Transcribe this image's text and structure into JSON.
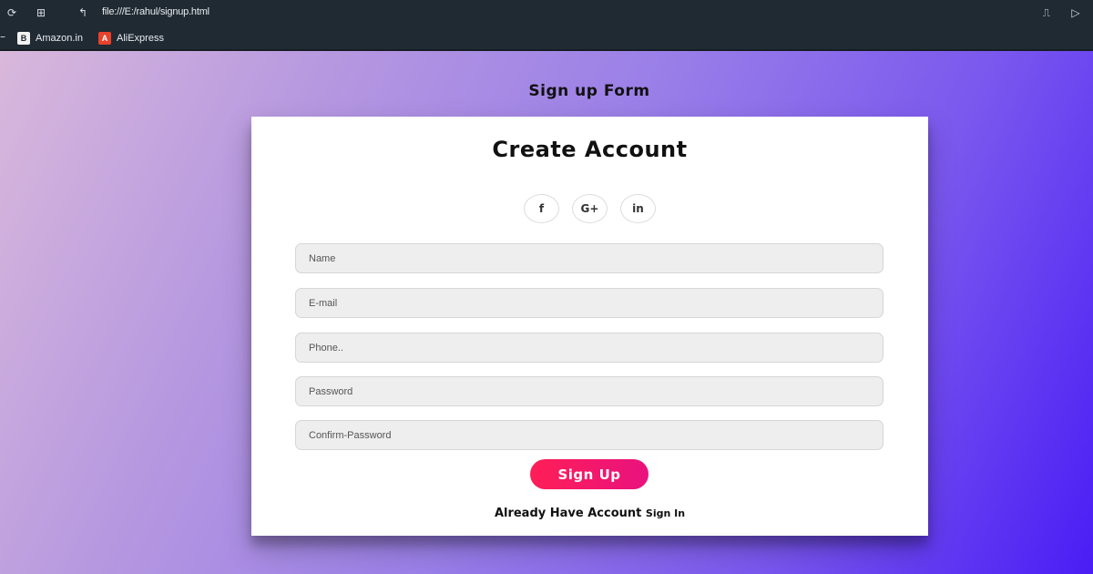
{
  "browser": {
    "url": "file:///E:/rahul/signup.html",
    "bookmarks": [
      {
        "label": "Amazon.in",
        "icon": "B"
      },
      {
        "label": "AliExpress",
        "icon": "A"
      }
    ]
  },
  "page": {
    "heading": "Sign up Form"
  },
  "form": {
    "title": "Create Account",
    "socials": [
      {
        "label": "f",
        "icon": "facebook-icon"
      },
      {
        "label": "G+",
        "icon": "google-plus-icon"
      },
      {
        "label": "in",
        "icon": "linkedin-icon"
      }
    ],
    "fields": {
      "name_placeholder": "Name",
      "email_placeholder": "E-mail",
      "phone_placeholder": "Phone..",
      "password_placeholder": "Password",
      "confirm_placeholder": "Confirm-Password"
    },
    "submit_label": "Sign Up",
    "already_text": "Already Have Account",
    "signin_label": "Sign In"
  },
  "colors": {
    "button_start": "#ff1e56",
    "button_end": "#e9127f",
    "chrome": "#202a33"
  }
}
